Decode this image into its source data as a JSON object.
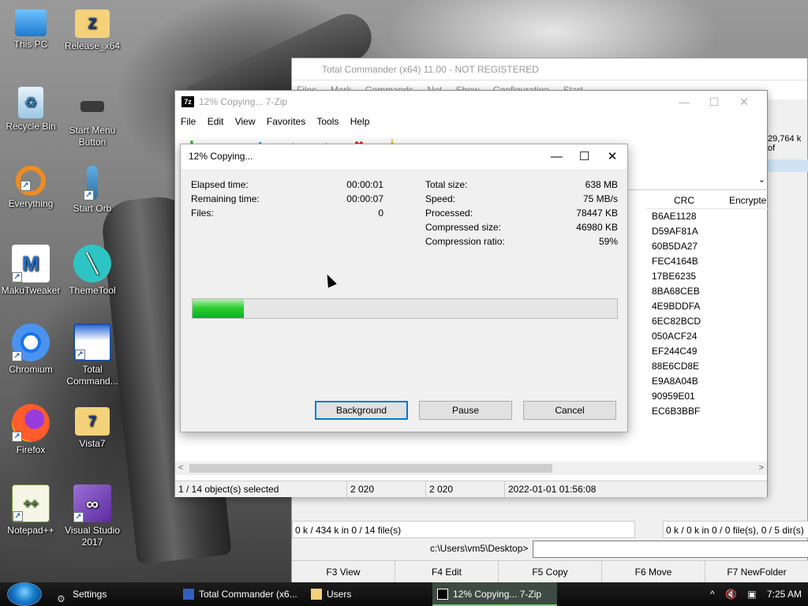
{
  "desktop": {
    "icons": [
      {
        "label": "This PC",
        "icon": "computer-icon"
      },
      {
        "label": "Release_x64",
        "icon": "folder-icon"
      },
      {
        "label": "Recycle Bin",
        "icon": "recycle-bin-icon"
      },
      {
        "label": "Start Menu Button",
        "icon": "start-menu-button-icon"
      },
      {
        "label": "Everything",
        "icon": "everything-search-icon"
      },
      {
        "label": "Start Orb",
        "icon": "start-orb-icon"
      },
      {
        "label": "MakuTweaker",
        "icon": "makutweaker-icon"
      },
      {
        "label": "ThemeTool",
        "icon": "themetool-icon"
      },
      {
        "label": "Chromium",
        "icon": "chromium-icon"
      },
      {
        "label": "Total Command...",
        "icon": "total-commander-icon"
      },
      {
        "label": "Firefox",
        "icon": "firefox-icon"
      },
      {
        "label": "Vista7",
        "icon": "folder-icon"
      },
      {
        "label": "Notepad++",
        "icon": "notepad-plus-plus-icon"
      },
      {
        "label": "Visual Studio 2017",
        "icon": "visual-studio-icon"
      }
    ]
  },
  "total_commander": {
    "title": "Total Commander (x64) 11.00 - NOT REGISTERED",
    "menu": [
      "Files",
      "Mark",
      "Commands",
      "Net",
      "Show",
      "Configuration",
      "Start"
    ],
    "right_header_size": "29,764 k of",
    "left_status": "0 k / 434 k in 0 / 14 file(s)",
    "right_status": "0 k / 0 k in 0 / 0 file(s), 0 / 5 dir(s)",
    "path": "c:\\Users\\vm5\\Desktop>",
    "fkeys": [
      "F3 View",
      "F4 Edit",
      "F5 Copy",
      "F6 Move",
      "F7 NewFolder"
    ]
  },
  "zip": {
    "title": "12% Copying... 7-Zip",
    "logo": "7z",
    "menu": [
      "File",
      "Edit",
      "View",
      "Favorites",
      "Tools",
      "Help"
    ],
    "columns": {
      "crc": "CRC",
      "encrypted": "Encrypte"
    },
    "crc_values": [
      "B6AE1128",
      "D59AF81A",
      "60B5DA27",
      "FEC4164B",
      "17BE6235",
      "8BA68CEB",
      "4E9BDDFA",
      "6EC82BCD",
      "050ACF24",
      "EF244C49",
      "88E6CD8E",
      "E9A8A04B",
      "90959E01",
      "EC6B3BBF"
    ],
    "status": {
      "selected": "1 / 14 object(s) selected",
      "size": "2 020",
      "packed": "2 020",
      "modified": "2022-01-01 01:56:08"
    }
  },
  "dialog": {
    "title": "12% Copying...",
    "left_stats": [
      {
        "label": "Elapsed time:",
        "value": "00:00:01"
      },
      {
        "label": "Remaining time:",
        "value": "00:00:07"
      },
      {
        "label": "Files:",
        "value": "0"
      }
    ],
    "right_stats": [
      {
        "label": "Total size:",
        "value": "638 MB"
      },
      {
        "label": "Speed:",
        "value": "75 MB/s"
      },
      {
        "label": "Processed:",
        "value": "78447 KB"
      },
      {
        "label": "Compressed size:",
        "value": "46980 KB"
      },
      {
        "label": "Compression ratio:",
        "value": "59%"
      }
    ],
    "progress_percent": 12,
    "buttons": {
      "background": "Background",
      "pause": "Pause",
      "cancel": "Cancel"
    }
  },
  "taskbar": {
    "items": [
      {
        "label": "Settings",
        "icon": "settings-gear-icon"
      },
      {
        "label": "Total Commander (x6...",
        "icon": "total-commander-icon"
      },
      {
        "label": "Users",
        "icon": "folder-icon"
      },
      {
        "label": "12% Copying... 7-Zip",
        "icon": "7zip-icon"
      }
    ],
    "clock": "7:25 AM"
  }
}
